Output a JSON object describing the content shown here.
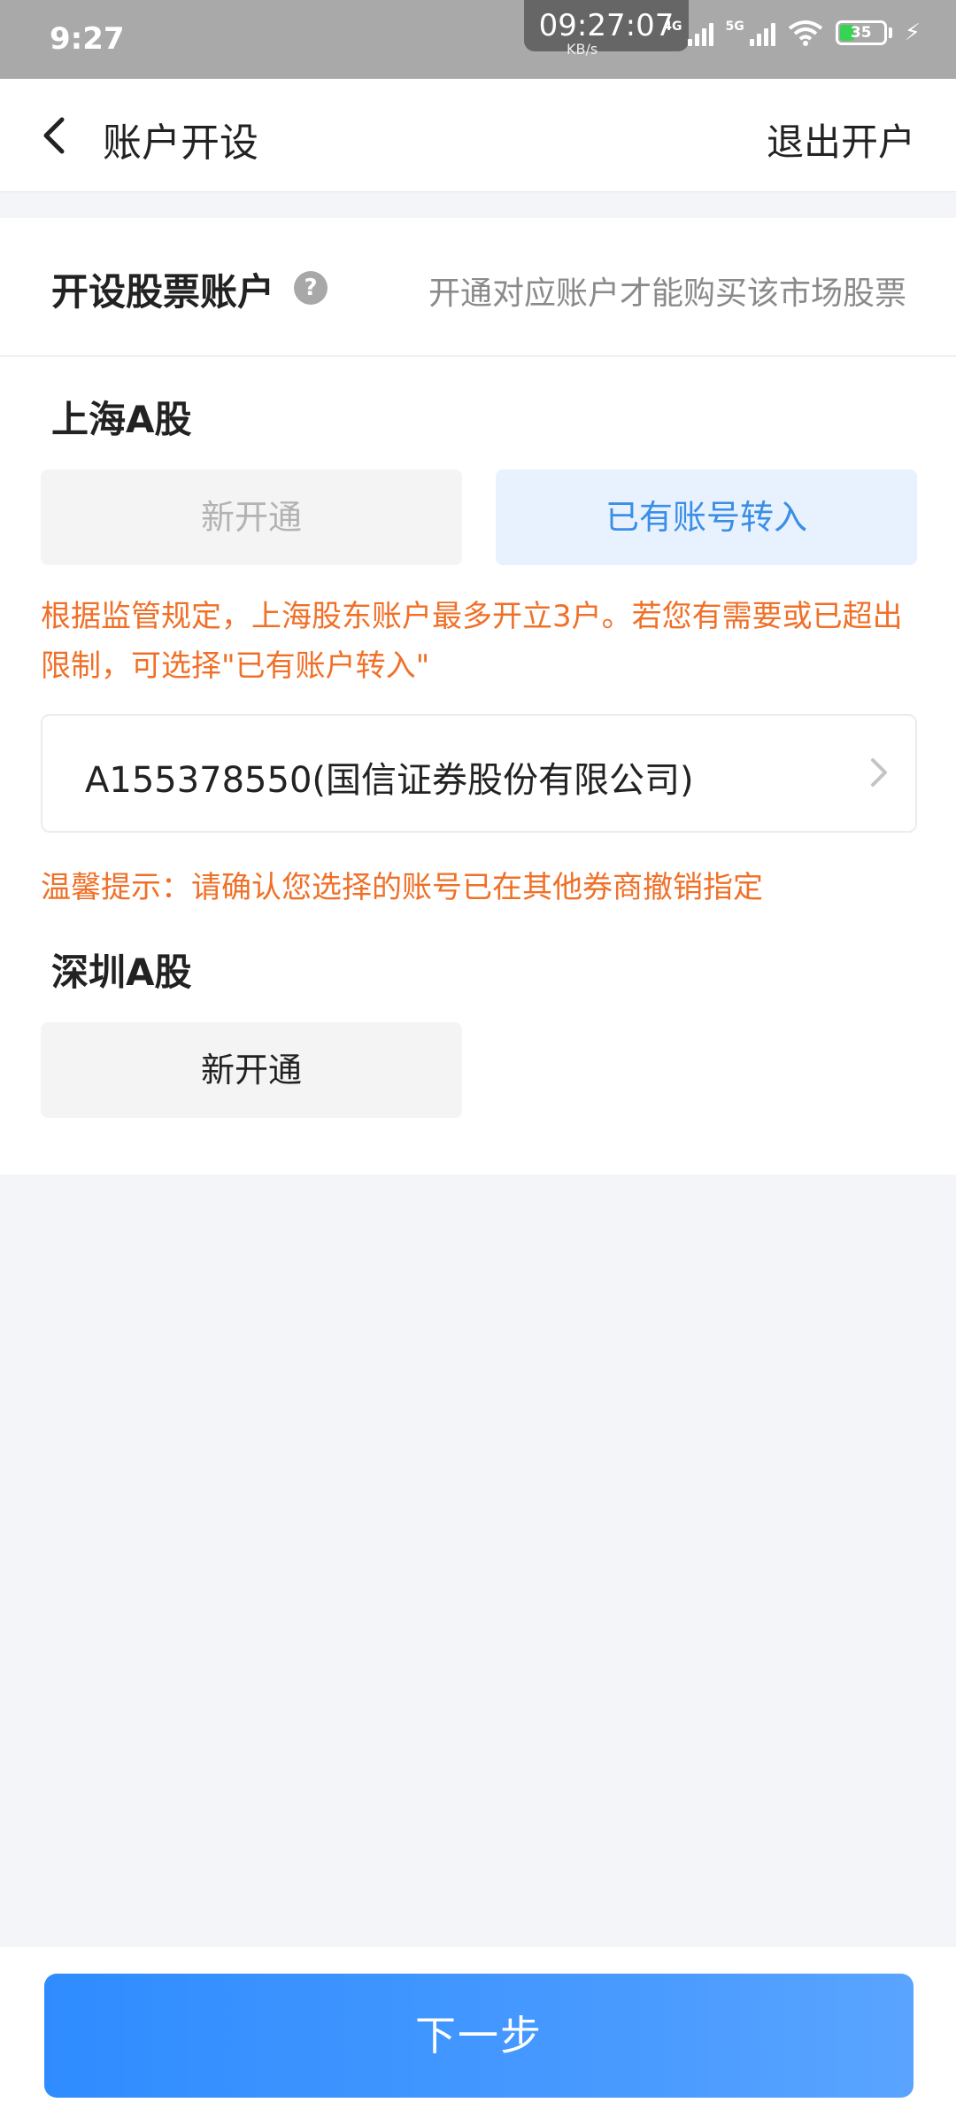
{
  "status_bar": {
    "time": "9:27",
    "clock_overlay": "09:27:07",
    "kbs": "KB/s",
    "net_5g": "5G",
    "net_4g": "4G",
    "battery": "35"
  },
  "nav": {
    "title": "账户开设",
    "exit_label": "退出开户"
  },
  "open_account": {
    "title": "开设股票账户",
    "help": "?",
    "hint": "开通对应账户才能购买该市场股票"
  },
  "shanghai": {
    "title": "上海A股",
    "new_open": "新开通",
    "transfer": "已有账号转入",
    "notice": "根据监管规定，上海股东账户最多开立3户。若您有需要或已超出限制，可选择\"已有账户转入\"",
    "account_value": "A155378550(国信证券股份有限公司)",
    "tip": "温馨提示：请确认您选择的账号已在其他券商撤销指定"
  },
  "shenzhen": {
    "title": "深圳A股",
    "new_open": "新开通"
  },
  "footer": {
    "next_label": "下一步"
  },
  "colors": {
    "primary": "#3a8ee6",
    "warning": "#f07028",
    "page_bg": "#f3f5f9"
  }
}
